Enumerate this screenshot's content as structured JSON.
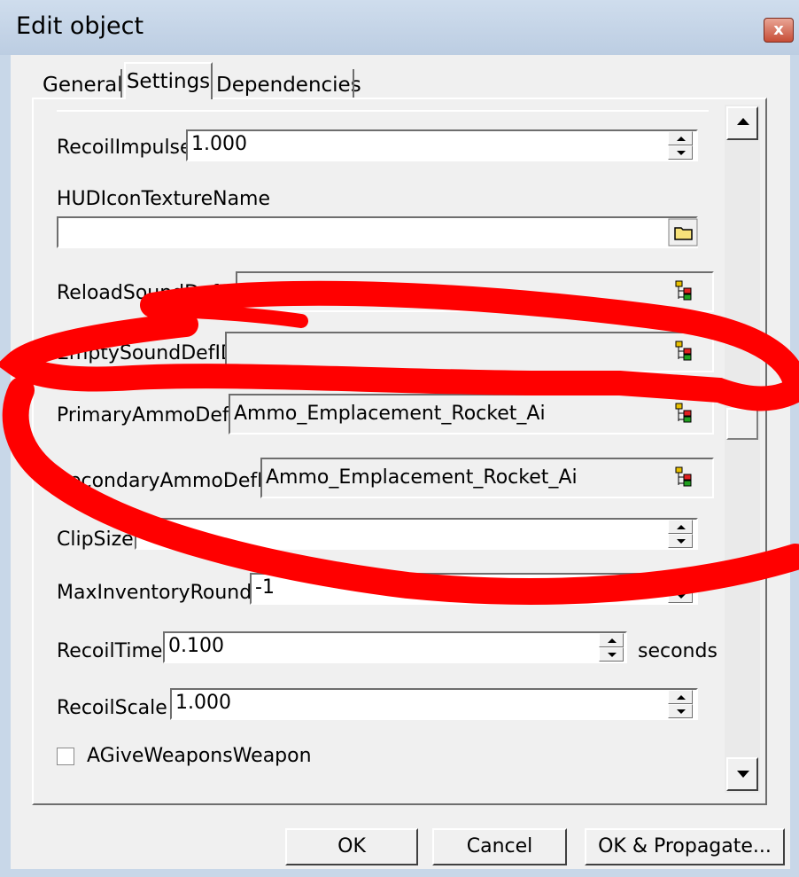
{
  "window": {
    "title": "Edit object",
    "close_glyph": "x"
  },
  "tabs": [
    {
      "label": "General",
      "active": false
    },
    {
      "label": "Settings",
      "active": true
    },
    {
      "label": "Dependencies",
      "active": false
    }
  ],
  "fields": {
    "recoil_impulse": {
      "label": "RecoilImpulse",
      "value": "1.000"
    },
    "hud_icon": {
      "label": "HUDIconTextureName",
      "value": ""
    },
    "reload_sound": {
      "label": "ReloadSoundDefID",
      "value": ""
    },
    "empty_sound": {
      "label": "EmptySoundDefID",
      "value": ""
    },
    "primary_ammo": {
      "label": "PrimaryAmmoDefID",
      "value": "Ammo_Emplacement_Rocket_Ai"
    },
    "secondary_ammo": {
      "label": "SecondaryAmmoDefID",
      "value": "Ammo_Emplacement_Rocket_Ai"
    },
    "clip_size": {
      "label": "ClipSize",
      "value": ""
    },
    "max_inventory": {
      "label": "MaxInventoryRounds",
      "value": "-1"
    },
    "recoil_time": {
      "label": "RecoilTime",
      "value": "0.100",
      "unit": "seconds"
    },
    "recoil_scale": {
      "label": "RecoilScale",
      "value": "1.000"
    },
    "give_weapons": {
      "label": "AGiveWeaponsWeapon",
      "checked": false
    }
  },
  "buttons": {
    "ok": "OK",
    "cancel": "Cancel",
    "ok_propagate": "OK & Propagate..."
  },
  "icons": {
    "spinner": "spinner-icon",
    "picker": "tree-picker-icon",
    "folder": "folder-icon",
    "scroll_up": "scroll-up-arrow-icon",
    "scroll_down": "scroll-down-arrow-icon"
  },
  "annotation": {
    "color": "#ff0000",
    "shape": "hand-drawn ellipse"
  }
}
